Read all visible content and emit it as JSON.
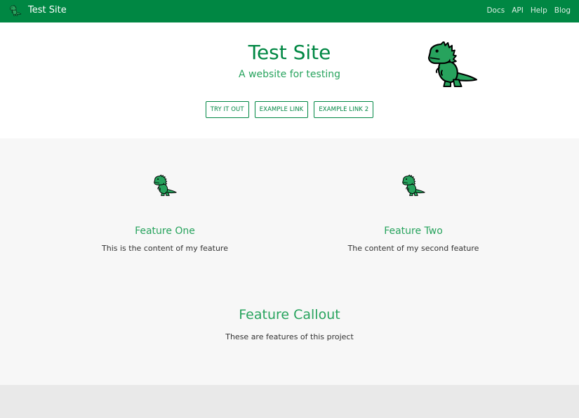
{
  "navbar": {
    "logo_icon": "dinosaur-icon",
    "title": "Test Site",
    "links": [
      "Docs",
      "API",
      "Help",
      "Blog"
    ]
  },
  "hero": {
    "title": "Test Site",
    "tagline": "A website for testing",
    "mascot_icon": "dinosaur-icon",
    "buttons": [
      "TRY IT OUT",
      "EXAMPLE LINK",
      "EXAMPLE LINK 2"
    ]
  },
  "features": [
    {
      "icon": "dinosaur-icon",
      "title": "Feature One",
      "text": "This is the content of my feature"
    },
    {
      "icon": "dinosaur-icon",
      "title": "Feature Two",
      "text": "The content of my second feature"
    }
  ],
  "callout": {
    "title": "Feature Callout",
    "text": "These are features of this project"
  },
  "colors": {
    "brand": "#008743",
    "accent_text": "#27a35d",
    "body_text": "#333333",
    "hero_bg": "#ffffff",
    "features_bg": "#f7f7f7",
    "footer_bg": "#e9e9e9"
  }
}
